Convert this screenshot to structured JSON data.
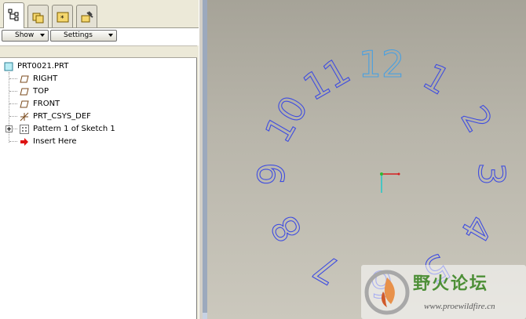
{
  "toolbar": {
    "show_label": "Show",
    "settings_label": "Settings"
  },
  "tree": {
    "root": "PRT0021.PRT",
    "items": [
      "RIGHT",
      "TOP",
      "FRONT",
      "PRT_CSYS_DEF",
      "Pattern 1 of Sketch 1",
      "Insert Here"
    ]
  },
  "clock": [
    "12",
    "1",
    "2",
    "3",
    "4",
    "5",
    "6",
    "7",
    "8",
    "9",
    "10",
    "11"
  ],
  "watermark": {
    "title": "野火论坛",
    "url": "www.proewildfire.cn"
  },
  "colors": {
    "outline": "#3f4de0",
    "selected": "#4aa0e0",
    "viewport": "#b8b5aa",
    "brand": "#4d8f37"
  }
}
